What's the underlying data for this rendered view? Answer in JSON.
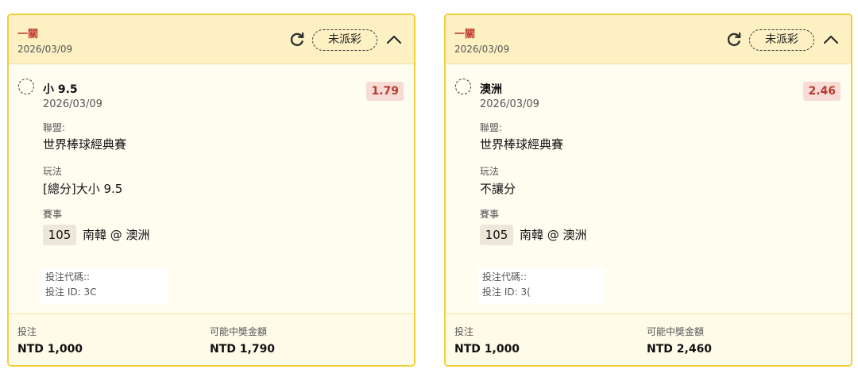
{
  "cards": [
    {
      "bet_type": "一關",
      "date": "2026/03/09",
      "status": "未派彩",
      "selection": {
        "name": "小 9.5",
        "date": "2026/03/09",
        "odds": "1.79",
        "league_label": "聯盟:",
        "league": "世界棒球經典賽",
        "play_label": "玩法",
        "play": "[總分]大小 9.5",
        "event_label": "賽事",
        "event_number": "105",
        "event_teams": "南韓 @ 澳洲"
      },
      "bet_code_label": "投注代碼::",
      "bet_id_label": "投注 ID: 3C",
      "stake_label": "投注",
      "stake": "NTD 1,000",
      "win_label": "可能中獎金額",
      "win": "NTD 1,790"
    },
    {
      "bet_type": "一關",
      "date": "2026/03/09",
      "status": "未派彩",
      "selection": {
        "name": "澳洲",
        "date": "2026/03/09",
        "odds": "2.46",
        "league_label": "聯盟:",
        "league": "世界棒球經典賽",
        "play_label": "玩法",
        "play": "不讓分",
        "event_label": "賽事",
        "event_number": "105",
        "event_teams": "南韓 @ 澳洲"
      },
      "bet_code_label": "投注代碼::",
      "bet_id_label": "投注 ID: 3(",
      "stake_label": "投注",
      "stake": "NTD 1,000",
      "win_label": "可能中獎金額",
      "win": "NTD 2,460"
    }
  ],
  "icons": {
    "refresh": "refresh-icon",
    "collapse": "chevron-up-icon",
    "selection": "dashed-circle-icon"
  },
  "colors": {
    "border": "#f3cf3a",
    "header_bg": "#fdf1c4",
    "card_bg": "#fffcf0",
    "bet_type": "#c0392b",
    "odds_bg": "#f7dcd6",
    "odds_text": "#b83a2c"
  }
}
